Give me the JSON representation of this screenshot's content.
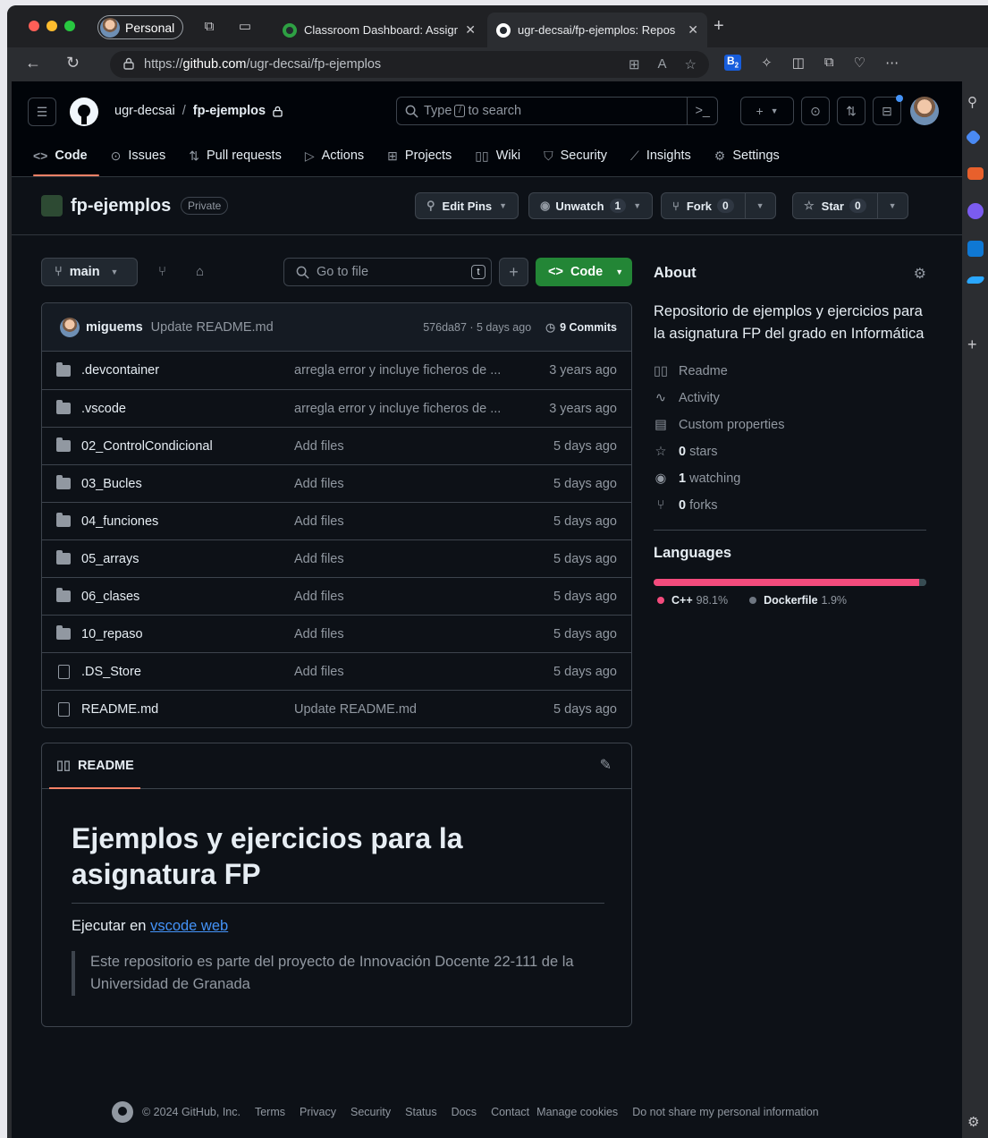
{
  "browser": {
    "profile_label": "Personal",
    "tabs": [
      {
        "title": "Classroom Dashboard: Assignm",
        "active": false
      },
      {
        "title": "ugr-decsai/fp-ejemplos: Repos",
        "active": true
      }
    ],
    "url_prefix": "https://",
    "url_host": "github.com",
    "url_path": "/ugr-decsai/fp-ejemplos",
    "extension_badge": "2"
  },
  "header": {
    "owner": "ugr-decsai",
    "separator": "/",
    "repo": "fp-ejemplos",
    "search_pre": "Type",
    "search_key": "/",
    "search_post": "to search"
  },
  "repo_nav": [
    {
      "label": "Code",
      "icon": "code-icon",
      "selected": true
    },
    {
      "label": "Issues",
      "icon": "issue-icon"
    },
    {
      "label": "Pull requests",
      "icon": "pull-request-icon"
    },
    {
      "label": "Actions",
      "icon": "play-icon"
    },
    {
      "label": "Projects",
      "icon": "table-icon"
    },
    {
      "label": "Wiki",
      "icon": "book-icon"
    },
    {
      "label": "Security",
      "icon": "shield-icon"
    },
    {
      "label": "Insights",
      "icon": "graph-icon"
    },
    {
      "label": "Settings",
      "icon": "gear-icon"
    }
  ],
  "repo_title": {
    "name": "fp-ejemplos",
    "visibility": "Private",
    "edit_pins": "Edit Pins",
    "unwatch": "Unwatch",
    "watch_count": "1",
    "fork": "Fork",
    "fork_count": "0",
    "star": "Star",
    "star_count": "0"
  },
  "toolbar": {
    "branch": "main",
    "go_to_file": "Go to file",
    "go_to_file_key": "t",
    "add": "+",
    "code": "Code"
  },
  "latest_commit": {
    "author": "miguems",
    "message": "Update README.md",
    "sha_time": "576da87 · 5 days ago",
    "commits": "9 Commits"
  },
  "files": [
    {
      "name": ".devcontainer",
      "type": "dir",
      "message": "arregla error y incluye ficheros de ...",
      "date": "3 years ago"
    },
    {
      "name": ".vscode",
      "type": "dir",
      "message": "arregla error y incluye ficheros de ...",
      "date": "3 years ago"
    },
    {
      "name": "02_ControlCondicional",
      "type": "dir",
      "message": "Add files",
      "date": "5 days ago"
    },
    {
      "name": "03_Bucles",
      "type": "dir",
      "message": "Add files",
      "date": "5 days ago"
    },
    {
      "name": "04_funciones",
      "type": "dir",
      "message": "Add files",
      "date": "5 days ago"
    },
    {
      "name": "05_arrays",
      "type": "dir",
      "message": "Add files",
      "date": "5 days ago"
    },
    {
      "name": "06_clases",
      "type": "dir",
      "message": "Add files",
      "date": "5 days ago"
    },
    {
      "name": "10_repaso",
      "type": "dir",
      "message": "Add files",
      "date": "5 days ago"
    },
    {
      "name": ".DS_Store",
      "type": "file",
      "message": "Add files",
      "date": "5 days ago"
    },
    {
      "name": "README.md",
      "type": "file",
      "message": "Update README.md",
      "date": "5 days ago"
    }
  ],
  "readme": {
    "tab_label": "README",
    "title": "Ejemplos y ejercicios para la asignatura FP",
    "run_prefix": "Ejecutar en",
    "run_link": "vscode web",
    "quote": "Este repositorio es parte del proyecto de Innovación Docente 22-111 de la Universidad de Granada"
  },
  "about": {
    "heading": "About",
    "description": "Repositorio de ejemplos y ejercicios para la asignatura FP del grado en Informática",
    "items": [
      {
        "icon": "book-icon",
        "bold": "",
        "text": "Readme"
      },
      {
        "icon": "pulse-icon",
        "bold": "",
        "text": "Activity"
      },
      {
        "icon": "note-icon",
        "bold": "",
        "text": "Custom properties"
      },
      {
        "icon": "star-icon",
        "bold": "0",
        "text": "stars"
      },
      {
        "icon": "eye-icon",
        "bold": "1",
        "text": "watching"
      },
      {
        "icon": "fork-icon",
        "bold": "0",
        "text": "forks"
      }
    ]
  },
  "languages": {
    "heading": "Languages",
    "items": [
      {
        "name": "C++",
        "percent": "98.1%",
        "value": 98.1,
        "color": "#f34b7d"
      },
      {
        "name": "Dockerfile",
        "percent": "1.9%",
        "value": 1.9,
        "color": "#384d54"
      }
    ]
  },
  "footer": {
    "copyright": "© 2024 GitHub, Inc.",
    "links": [
      "Terms",
      "Privacy",
      "Security",
      "Status",
      "Docs",
      "Contact",
      "Manage cookies",
      "Do not share my personal information"
    ]
  },
  "colors": {
    "accent_green": "#238636",
    "underline": "#f78166",
    "link": "#4493f8"
  }
}
